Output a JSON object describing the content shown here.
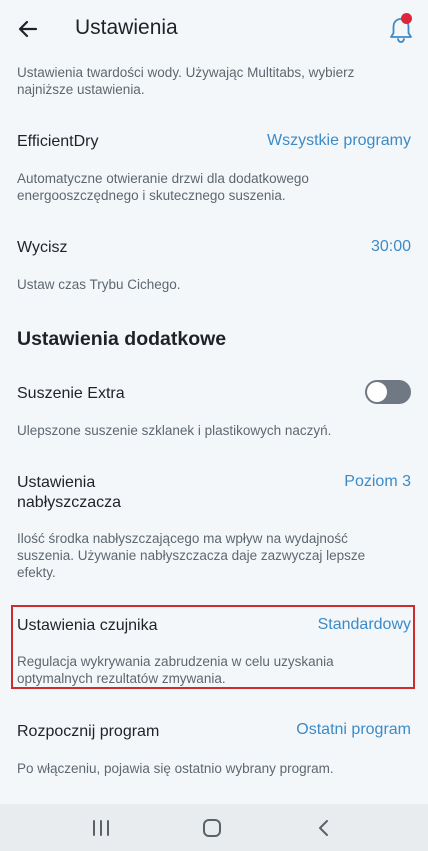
{
  "header": {
    "title": "Ustawienia",
    "back_icon": "arrow-left-icon",
    "bell_icon": "bell-icon",
    "accent": "#3c8bc8",
    "notification_color": "#e0253a"
  },
  "settings": {
    "water_hardness_desc": "Ustawienia twardości wody. Używając Multitabs, wybierz najniższe ustawienia.",
    "efficient_dry": {
      "label": "EfficientDry",
      "value": "Wszystkie programy",
      "desc": "Automatyczne otwieranie drzwi dla dodatkowego energooszczędnego i skutecznego suszenia."
    },
    "silence": {
      "label": "Wycisz",
      "value": "30:00",
      "desc": "Ustaw czas Trybu Cichego."
    },
    "extra_section_title": "Ustawienia dodatkowe",
    "extra_dry": {
      "label": "Suszenie Extra",
      "toggle_on": false,
      "desc": "Ulepszone suszenie szklanek i plastikowych naczyń."
    },
    "rinse_aid": {
      "label_line1": "Ustawienia",
      "label_line2": "nabłyszczacza",
      "value": "Poziom 3",
      "desc": "Ilość środka nabłyszczającego ma wpływ na wydajność suszenia. Używanie nabłyszczacza daje zazwyczaj lepsze efekty."
    },
    "sensor": {
      "label": "Ustawienia czujnika",
      "value": "Standardowy",
      "desc": "Regulacja wykrywania zabrudzenia w celu uzyskania optymalnych rezultatów zmywania.",
      "highlight_color": "#cc2e2e"
    },
    "start_program": {
      "label": "Rozpocznij program",
      "value": "Ostatni program",
      "desc": "Po włączeniu, pojawia się ostatnio wybrany program."
    }
  },
  "navbar": {
    "recent_icon": "recent-apps-icon",
    "home_icon": "home-icon",
    "back_icon": "back-chevron-icon"
  }
}
